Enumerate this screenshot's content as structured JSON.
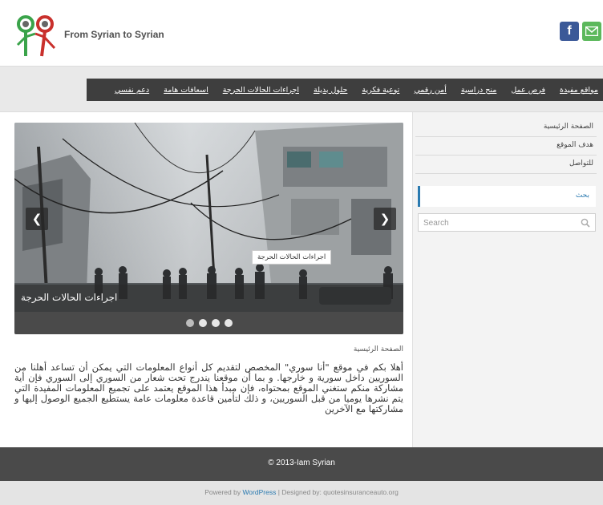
{
  "header": {
    "site_title": "From Syrian to Syrian",
    "social": {
      "facebook_glyph": "f",
      "facebook_icon": "facebook-icon",
      "mail_icon": "mail-icon"
    }
  },
  "nav": {
    "items": [
      "دعم نفسي",
      "اسعافات هامة",
      "اجراءات الحالات الحرجة",
      "حلول بديلة",
      "توعية فكرية",
      "أمن رقمي",
      "منح دراسية",
      "فرص عمل",
      "مواقع مفيدة"
    ]
  },
  "slider": {
    "caption": "اجراءات الحالات الحرجة",
    "tooltip": "اجراءات الحالات الحرجة",
    "prev_glyph": "❮",
    "next_glyph": "❯",
    "dot_count": 4,
    "active_dot": 0
  },
  "content": {
    "breadcrumb": "الصفحة الرئيسية",
    "intro": "أهلا بكم في موقع \"أنا سوري\" المخصص لتقديم كل أنواع المعلومات التي يمكن أن تساعد أهلنا من السوريين داخل سورية و خارجها. و بما أن موقعنا يندرج تحت شعار من السوري إلى السوري فإن أية مشاركة منكم ستغني الموقع بمحتواه، فإن مبدأ هذا الموقع يعتمد على تجميع المعلومات المفيدة التي يتم نشرها يوميا من قبل السوريين، و ذلك لتأمين قاعدة معلومات عامة يستطيع الجميع الوصول إليها و مشاركتها مع الآخرين"
  },
  "sidebar": {
    "links": [
      "الصفحة الرئيسية",
      "هدف الموقع",
      "للتواصل"
    ],
    "search_title": "بحث",
    "search_placeholder": "Search"
  },
  "footer": {
    "copyright": "© 2013-Iam Syrian",
    "powered_prefix": "Powered by ",
    "powered_link": "WordPress",
    "designed_by": " | Designed by: quotesinsuranceauto.org"
  },
  "colors": {
    "nav_bg": "#3e3e3e",
    "footer_bg": "#4a4a4a",
    "accent": "#2a7ab0",
    "facebook": "#3b5998",
    "mail": "#5cb85c"
  }
}
